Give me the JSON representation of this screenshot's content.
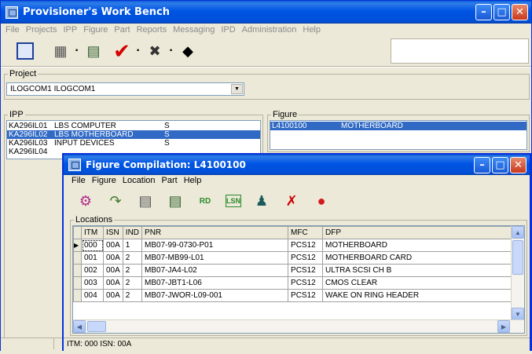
{
  "main_window": {
    "title": "Provisioner's Work Bench",
    "menu": [
      "File",
      "Projects",
      "IPP",
      "Figure",
      "Part",
      "Reports",
      "Messaging",
      "IPD",
      "Administration",
      "Help"
    ],
    "toolbar_icons": [
      "project-icon",
      "tree-icon",
      "dropdown-dot",
      "document-icon",
      "check-icon",
      "dropdown-dot",
      "connector-icon",
      "dropdown-dot",
      "diamond-icon"
    ],
    "project_label": "Project",
    "project_value": "ILOGCOM1  ILOGCOM1",
    "ipp_label": "IPP",
    "ipp_rows": [
      {
        "code": "KA296IL01",
        "name": "LBS COMPUTER",
        "type": "S"
      },
      {
        "code": "KA296IL02",
        "name": "LBS MOTHERBOARD",
        "type": "S"
      },
      {
        "code": "KA296IL03",
        "name": "INPUT DEVICES",
        "type": "S"
      },
      {
        "code": "KA296IL04",
        "name": "",
        "type": ""
      }
    ],
    "figure_label": "Figure",
    "figure_rows": [
      {
        "code": "L4100100",
        "name": "MOTHERBOARD"
      }
    ]
  },
  "dialog": {
    "title": "Figure Compilation: L4100100",
    "menu": [
      "File",
      "Figure",
      "Location",
      "Part",
      "Help"
    ],
    "toolbar_icons": [
      "add-location-icon",
      "move-icon",
      "numbering-icon",
      "document-icon",
      "rd-icon",
      "lsn-icon",
      "people-icon",
      "tree-delete-icon",
      "stop-icon"
    ],
    "locations_label": "Locations",
    "columns": [
      "ITM",
      "ISN",
      "IND",
      "PNR",
      "MFC",
      "DFP"
    ],
    "rows": [
      [
        "000",
        "00A",
        "1",
        "MB07-99-0730-P01",
        "PCS12",
        "MOTHERBOARD"
      ],
      [
        "001",
        "00A",
        "2",
        "MB07-MB99-L01",
        "PCS12",
        "MOTHERBOARD CARD"
      ],
      [
        "002",
        "00A",
        "2",
        "MB07-JA4-L02",
        "PCS12",
        "ULTRA SCSI CH B"
      ],
      [
        "003",
        "00A",
        "2",
        "MB07-JBT1-L06",
        "PCS12",
        "CMOS CLEAR"
      ],
      [
        "004",
        "00A",
        "2",
        "MB07-JWOR-L09-001",
        "PCS12",
        "WAKE ON RING HEADER"
      ]
    ],
    "status_text": "ITM: 000  ISN: 00A"
  }
}
